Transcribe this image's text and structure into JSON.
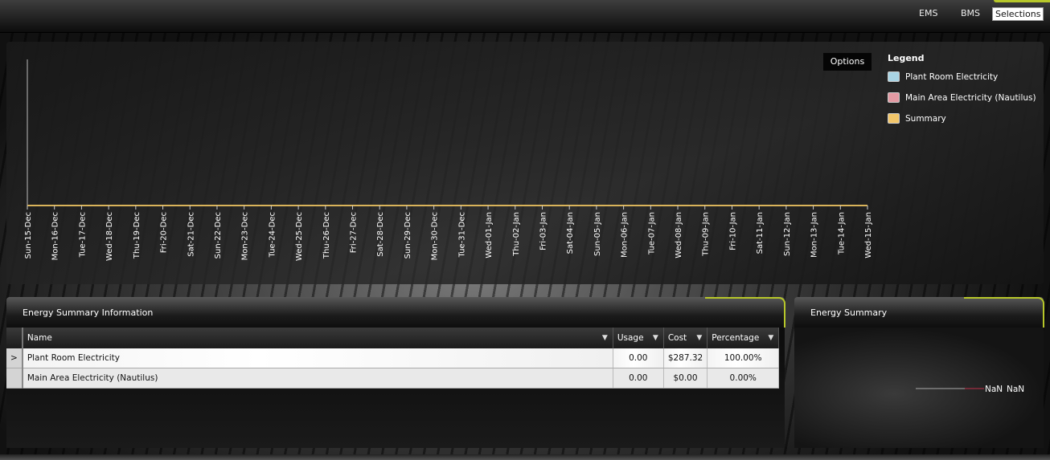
{
  "nav": {
    "ems": "EMS",
    "bms": "BMS",
    "selections": "Selections"
  },
  "chart_options_label": "Options",
  "legend": {
    "title": "Legend",
    "items": [
      {
        "label": "Plant Room Electricity",
        "color": "#a9d4e4"
      },
      {
        "label": "Main Area Electricity (Nautilus)",
        "color": "#e39aa3"
      },
      {
        "label": "Summary",
        "color": "#f2c66a"
      }
    ]
  },
  "chart_data": {
    "type": "line",
    "categories": [
      "Sun-15-Dec",
      "Mon-16-Dec",
      "Tue-17-Dec",
      "Wed-18-Dec",
      "Thu-19-Dec",
      "Fri-20-Dec",
      "Sat-21-Dec",
      "Sun-22-Dec",
      "Mon-23-Dec",
      "Tue-24-Dec",
      "Wed-25-Dec",
      "Thu-26-Dec",
      "Fri-27-Dec",
      "Sat-28-Dec",
      "Sun-29-Dec",
      "Mon-30-Dec",
      "Tue-31-Dec",
      "Wed-01-Jan",
      "Thu-02-Jan",
      "Fri-03-Jan",
      "Sat-04-Jan",
      "Sun-05-Jan",
      "Mon-06-Jan",
      "Tue-07-Jan",
      "Wed-08-Jan",
      "Thu-09-Jan",
      "Fri-10-Jan",
      "Sat-11-Jan",
      "Sun-12-Jan",
      "Mon-13-Jan",
      "Tue-14-Jan",
      "Wed-15-Jan"
    ],
    "series": [
      {
        "name": "Summary",
        "color": "#d9b35a",
        "values": [
          0,
          0,
          0,
          0,
          0,
          0,
          0,
          0,
          0,
          0,
          0,
          0,
          0,
          0,
          0,
          0,
          0,
          0,
          0,
          0,
          0,
          0,
          0,
          0,
          0,
          0,
          0,
          0,
          0,
          0,
          0,
          0
        ]
      }
    ],
    "grid": false,
    "legend_position": "right"
  },
  "energy_info": {
    "title": "Energy Summary Information",
    "columns": [
      "Name",
      "Usage",
      "Cost",
      "Percentage"
    ],
    "rows": [
      {
        "expander": ">",
        "name": "Plant Room Electricity",
        "usage": "0.00",
        "cost": "$287.32",
        "percentage": "100.00%"
      },
      {
        "expander": "",
        "name": "Main Area Electricity (Nautilus)",
        "usage": "0.00",
        "cost": "$0.00",
        "percentage": "0.00%"
      }
    ]
  },
  "energy_summary": {
    "title": "Energy Summary",
    "label_a": "NaN",
    "label_b": "NaN"
  }
}
